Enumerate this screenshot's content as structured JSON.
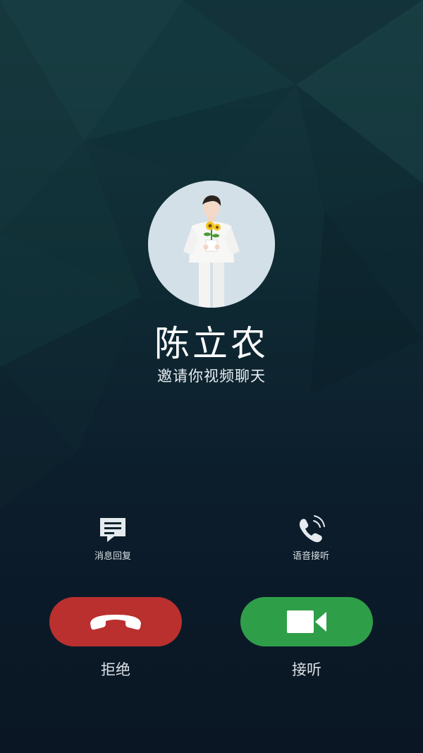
{
  "caller": {
    "name": "陈立农",
    "status": "邀请你视频聊天"
  },
  "quick_actions": {
    "message_reply": "消息回复",
    "voice_answer": "语音接听"
  },
  "buttons": {
    "decline": "拒绝",
    "accept": "接听"
  },
  "icons": {
    "message_reply": "message-bubble-icon",
    "voice_answer": "phone-handset-icon",
    "decline": "hang-up-icon",
    "accept": "video-camera-icon"
  },
  "colors": {
    "background": "#0c1c2a",
    "decline": "#b9302f",
    "accept": "#2f9e49"
  }
}
